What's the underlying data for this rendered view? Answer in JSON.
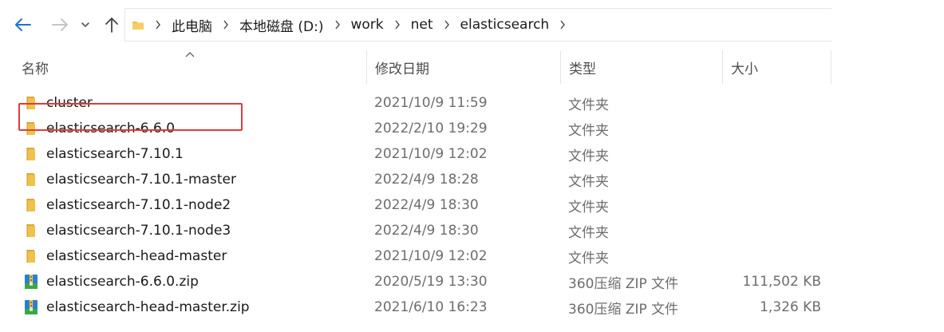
{
  "address_bar": {
    "breadcrumbs": [
      "此电脑",
      "本地磁盘 (D:)",
      "work",
      "net",
      "elasticsearch"
    ]
  },
  "columns": {
    "name": "名称",
    "date": "修改日期",
    "type": "类型",
    "size": "大小"
  },
  "files": [
    {
      "name": "cluster",
      "date": "2021/10/9 11:59",
      "type": "文件夹",
      "size": "",
      "icon": "folder-icon"
    },
    {
      "name": "elasticsearch-6.6.0",
      "date": "2022/2/10 19:29",
      "type": "文件夹",
      "size": "",
      "icon": "folder-icon"
    },
    {
      "name": "elasticsearch-7.10.1",
      "date": "2021/10/9 12:02",
      "type": "文件夹",
      "size": "",
      "icon": "folder-icon"
    },
    {
      "name": "elasticsearch-7.10.1-master",
      "date": "2022/4/9 18:28",
      "type": "文件夹",
      "size": "",
      "icon": "folder-icon"
    },
    {
      "name": "elasticsearch-7.10.1-node2",
      "date": "2022/4/9 18:30",
      "type": "文件夹",
      "size": "",
      "icon": "folder-icon"
    },
    {
      "name": "elasticsearch-7.10.1-node3",
      "date": "2022/4/9 18:30",
      "type": "文件夹",
      "size": "",
      "icon": "folder-icon"
    },
    {
      "name": "elasticsearch-head-master",
      "date": "2021/10/9 12:02",
      "type": "文件夹",
      "size": "",
      "icon": "folder-icon"
    },
    {
      "name": "elasticsearch-6.6.0.zip",
      "date": "2020/5/19 13:30",
      "type": "360压缩 ZIP 文件",
      "size": "111,502 KB",
      "icon": "zip-archive-icon"
    },
    {
      "name": "elasticsearch-head-master.zip",
      "date": "2021/6/10 16:23",
      "type": "360压缩 ZIP 文件",
      "size": "1,326 KB",
      "icon": "zip-archive-icon"
    }
  ],
  "colors": {
    "folder": "#f0c14b",
    "folder_dark": "#dca83a",
    "back_arrow": "#1e73d0",
    "highlight_border": "#e03b3b",
    "zip_blue": "#2a7fd4",
    "zip_green": "#3aa845"
  }
}
